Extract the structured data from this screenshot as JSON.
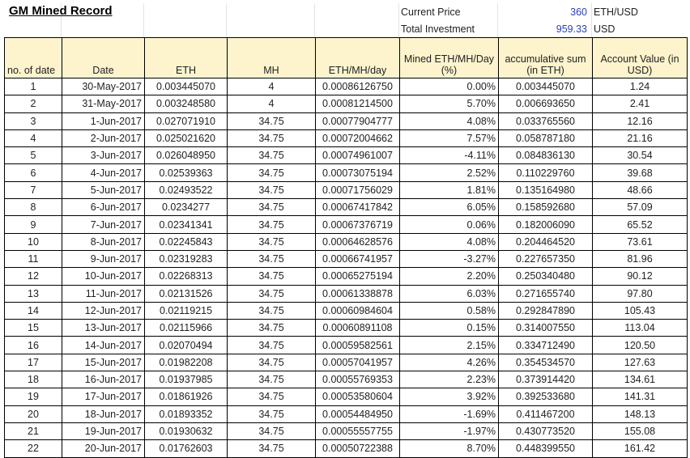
{
  "title": "GM Mined Record",
  "summary": {
    "current_price_label": "Current Price",
    "current_price_value": "360",
    "current_price_unit": "ETH/USD",
    "total_investment_label": "Total Investment",
    "total_investment_value": "959.33",
    "total_investment_unit": "USD"
  },
  "headers": [
    "no. of date",
    "Date",
    "ETH",
    "MH",
    "ETH/MH/day",
    "Mined ETH/MH/Day (%)",
    "accumulative sum (in ETH)",
    "Account Value (in USD)"
  ],
  "rows": [
    [
      "1",
      "30-May-2017",
      "0.003445070",
      "4",
      "0.00086126750",
      "0.00%",
      "0.003445070",
      "1.24"
    ],
    [
      "2",
      "31-May-2017",
      "0.003248580",
      "4",
      "0.00081214500",
      "5.70%",
      "0.006693650",
      "2.41"
    ],
    [
      "3",
      "1-Jun-2017",
      "0.027071910",
      "34.75",
      "0.00077904777",
      "4.08%",
      "0.033765560",
      "12.16"
    ],
    [
      "4",
      "2-Jun-2017",
      "0.025021620",
      "34.75",
      "0.00072004662",
      "7.57%",
      "0.058787180",
      "21.16"
    ],
    [
      "5",
      "3-Jun-2017",
      "0.026048950",
      "34.75",
      "0.00074961007",
      "-4.11%",
      "0.084836130",
      "30.54"
    ],
    [
      "6",
      "4-Jun-2017",
      "0.02539363",
      "34.75",
      "0.00073075194",
      "2.52%",
      "0.110229760",
      "39.68"
    ],
    [
      "7",
      "5-Jun-2017",
      "0.02493522",
      "34.75",
      "0.00071756029",
      "1.81%",
      "0.135164980",
      "48.66"
    ],
    [
      "8",
      "6-Jun-2017",
      "0.0234277",
      "34.75",
      "0.00067417842",
      "6.05%",
      "0.158592680",
      "57.09"
    ],
    [
      "9",
      "7-Jun-2017",
      "0.02341341",
      "34.75",
      "0.00067376719",
      "0.06%",
      "0.182006090",
      "65.52"
    ],
    [
      "10",
      "8-Jun-2017",
      "0.02245843",
      "34.75",
      "0.00064628576",
      "4.08%",
      "0.204464520",
      "73.61"
    ],
    [
      "11",
      "9-Jun-2017",
      "0.02319283",
      "34.75",
      "0.00066741957",
      "-3.27%",
      "0.227657350",
      "81.96"
    ],
    [
      "12",
      "10-Jun-2017",
      "0.02268313",
      "34.75",
      "0.00065275194",
      "2.20%",
      "0.250340480",
      "90.12"
    ],
    [
      "13",
      "11-Jun-2017",
      "0.02131526",
      "34.75",
      "0.00061338878",
      "6.03%",
      "0.271655740",
      "97.80"
    ],
    [
      "14",
      "12-Jun-2017",
      "0.02119215",
      "34.75",
      "0.00060984604",
      "0.58%",
      "0.292847890",
      "105.43"
    ],
    [
      "15",
      "13-Jun-2017",
      "0.02115966",
      "34.75",
      "0.00060891108",
      "0.15%",
      "0.314007550",
      "113.04"
    ],
    [
      "16",
      "14-Jun-2017",
      "0.02070494",
      "34.75",
      "0.00059582561",
      "2.15%",
      "0.334712490",
      "120.50"
    ],
    [
      "17",
      "15-Jun-2017",
      "0.01982208",
      "34.75",
      "0.00057041957",
      "4.26%",
      "0.354534570",
      "127.63"
    ],
    [
      "18",
      "16-Jun-2017",
      "0.01937985",
      "34.75",
      "0.00055769353",
      "2.23%",
      "0.373914420",
      "134.61"
    ],
    [
      "19",
      "17-Jun-2017",
      "0.01861926",
      "34.75",
      "0.00053580604",
      "3.92%",
      "0.392533680",
      "141.31"
    ],
    [
      "20",
      "18-Jun-2017",
      "0.01893352",
      "34.75",
      "0.00054484950",
      "-1.69%",
      "0.411467200",
      "148.13"
    ],
    [
      "21",
      "19-Jun-2017",
      "0.01930632",
      "34.75",
      "0.00055557755",
      "-1.97%",
      "0.430773520",
      "155.08"
    ],
    [
      "22",
      "20-Jun-2017",
      "0.01762603",
      "34.75",
      "0.00050722388",
      "8.70%",
      "0.448399550",
      "161.42"
    ]
  ]
}
